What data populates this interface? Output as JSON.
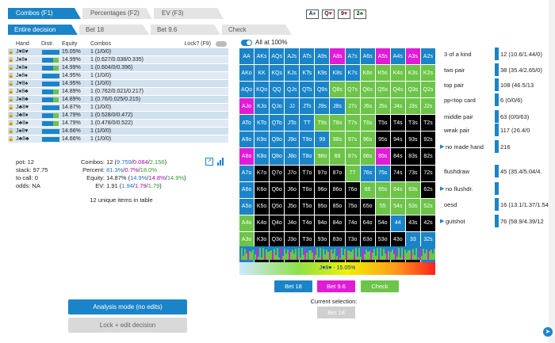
{
  "tabs_top": [
    {
      "label": "Combos (F1)",
      "active": true
    },
    {
      "label": "Percentages (F2)",
      "active": false
    },
    {
      "label": "EV (F3)",
      "active": false
    }
  ],
  "tabs_sub": [
    {
      "label": "Entire decision",
      "active": true
    },
    {
      "label": "Bet 18",
      "active": false
    },
    {
      "label": "Bet 9.6",
      "active": false
    },
    {
      "label": "Check",
      "active": false
    }
  ],
  "board": [
    {
      "rank": "A",
      "suit": "♦",
      "color": "#1b6fd0"
    },
    {
      "rank": "Q",
      "suit": "♥",
      "color": "#d11b1b"
    },
    {
      "rank": "9",
      "suit": "♥",
      "color": "#d11b1b"
    },
    {
      "rank": "2",
      "suit": "♣",
      "color": "#1e8a1e"
    }
  ],
  "hand_table": {
    "headers": {
      "hand": "Hand",
      "distr": "Distr.",
      "equity": "Equity",
      "combos": "Combos",
      "lock": "Lock? (F9)"
    },
    "rows": [
      {
        "hand": "J♥8♥",
        "equity": "15.05%",
        "combos": "1 (1/0/0)",
        "distr": "blue"
      },
      {
        "hand": "J♦8♦",
        "equity": "14.99%",
        "combos": "1 (0.627/0.038/0.335)",
        "distr": "mix"
      },
      {
        "hand": "J♦8♠",
        "equity": "14.99%",
        "combos": "1 (0.604/0/0.396)",
        "distr": "mix"
      },
      {
        "hand": "J♠8♠",
        "equity": "14.95%",
        "combos": "1 (1/0/0)",
        "distr": "blue"
      },
      {
        "hand": "J♥8♠",
        "equity": "14.95%",
        "combos": "1 (1/0/0)",
        "distr": "blue"
      },
      {
        "hand": "J♦8♣",
        "equity": "14.89%",
        "combos": "1 (0.762/0.021/0.217)",
        "distr": "mix"
      },
      {
        "hand": "J♠8♣",
        "equity": "14.89%",
        "combos": "1 (0.76/0.025/0.215)",
        "distr": "mix"
      },
      {
        "hand": "J♣8♥",
        "equity": "14.87%",
        "combos": "1 (1/0/0)",
        "distr": "blue"
      },
      {
        "hand": "J♣8♦",
        "equity": "14.79%",
        "combos": "1 (0.528/0/0.472)",
        "distr": "mix"
      },
      {
        "hand": "J♣8♠",
        "equity": "14.79%",
        "combos": "1 (0.478/0/0.522)",
        "distr": "mix"
      },
      {
        "hand": "J♠8♥",
        "equity": "14.66%",
        "combos": "1 (1/0/0)",
        "distr": "blue"
      },
      {
        "hand": "J♣8♣",
        "equity": "14.66%",
        "combos": "1 (1/0/0)",
        "distr": "blue"
      }
    ]
  },
  "stats": {
    "pot": "pot: 12",
    "stack": "stack: 97.75",
    "to_call": "to call: 0",
    "odds": "odds: NA",
    "combos_label": "Combos:",
    "combos_a": "12 (",
    "combos_b": "9.759",
    "combos_c": "/",
    "combos_d": "0.084",
    "combos_e": "/",
    "combos_f": "2.156",
    "combos_g": ")",
    "percent_label": "Percent:",
    "percent_b": "81.3%",
    "percent_d": "0.7%",
    "percent_f": "18.0%",
    "equity_label": "Equity:",
    "equity_a": "14.87% (",
    "equity_b": "14.9%",
    "equity_d": "14.8%",
    "equity_f": "14.9%",
    "equity_g": ")",
    "ev_label": "EV:",
    "ev_a": "1.91 (",
    "ev_b": "1.94",
    "ev_d": "1.79",
    "ev_f": "1.79",
    "ev_g": ")",
    "unique": "12 unique items in table"
  },
  "buttons": {
    "analysis": "Analysis mode (no edits)",
    "lock": "Lock + edit decision"
  },
  "grid": {
    "all_label": "All at 100%",
    "cells": [
      "AA",
      "AKs",
      "AQs",
      "AJs",
      "ATs",
      "A9s",
      "A8s",
      "A7s",
      "A6s",
      "A5s",
      "A4s",
      "A3s",
      "A2s",
      "AKo",
      "KK",
      "KQs",
      "KJs",
      "KTs",
      "K9s",
      "K8s",
      "K7s",
      "K6s",
      "K5s",
      "K4s",
      "K3s",
      "K2s",
      "AQo",
      "KQo",
      "QQ",
      "QJs",
      "QTs",
      "Q9s",
      "Q8s",
      "Q7s",
      "Q6s",
      "Q5s",
      "Q4s",
      "Q3s",
      "Q2s",
      "AJo",
      "KJo",
      "QJo",
      "JJ",
      "JTs",
      "J9s",
      "J8s",
      "J7s",
      "J6s",
      "J5s",
      "J4s",
      "J3s",
      "J2s",
      "ATo",
      "KTo",
      "QTo",
      "JTo",
      "TT",
      "T9s",
      "T8s",
      "T7s",
      "T6s",
      "T5s",
      "T4s",
      "T3s",
      "T2s",
      "A9o",
      "K9o",
      "Q9o",
      "J9o",
      "T9o",
      "99",
      "98s",
      "97s",
      "96s",
      "95s",
      "94s",
      "93s",
      "92s",
      "A8o",
      "K8o",
      "Q8o",
      "J8o",
      "T8o",
      "98o",
      "88",
      "87s",
      "86s",
      "85s",
      "84s",
      "83s",
      "82s",
      "A7o",
      "K7o",
      "Q7o",
      "J7o",
      "T7o",
      "97o",
      "87o",
      "77",
      "76s",
      "75s",
      "74s",
      "73s",
      "72s",
      "A6o",
      "K6o",
      "Q6o",
      "J6o",
      "T6o",
      "96o",
      "86o",
      "76o",
      "66",
      "65s",
      "64s",
      "63s",
      "62s",
      "A5o",
      "K5o",
      "Q5o",
      "J5o",
      "T5o",
      "95o",
      "85o",
      "75o",
      "65o",
      "55",
      "54s",
      "53s",
      "52s",
      "A4o",
      "K4o",
      "Q4o",
      "J4o",
      "T4o",
      "94o",
      "84o",
      "74o",
      "64o",
      "54o",
      "44",
      "43s",
      "42s",
      "A3o",
      "K3o",
      "Q3o",
      "J3o",
      "T3o",
      "93o",
      "83o",
      "73o",
      "63o",
      "53o",
      "43o",
      "33",
      "32s",
      "A2o",
      "K2o",
      "Q2o",
      "J2o",
      "T2o",
      "92o",
      "82o",
      "72o",
      "62o",
      "52o",
      "42o",
      "32o",
      "22"
    ],
    "colors": [
      "#1b84c8",
      "#1b84c8",
      "#1b84c8",
      "#1b84c8",
      "#1b84c8",
      "#1b84c8",
      "#e01cd6",
      "#1b84c8",
      "#1b84c8",
      "#e01cd6",
      "#1b84c8",
      "#e01cd6",
      "#1b84c8",
      "#1b84c8",
      "#1b84c8",
      "#1b84c8",
      "#1b84c8",
      "#1b84c8",
      "#1b84c8",
      "#1b84c8",
      "#1b84c8",
      "#6cc448",
      "#6cc448",
      "#6cc448",
      "#6cc448",
      "#6cc448",
      "#1b84c8",
      "#1b84c8",
      "#1b84c8",
      "#1b84c8",
      "#1b84c8",
      "#1b84c8",
      "#6cc448",
      "#6cc448",
      "#6cc448",
      "#6cc448",
      "#6cc448",
      "#6cc448",
      "#6cc448",
      "#e01cd6",
      "#1b84c8",
      "#1b84c8",
      "#1b84c8",
      "#1b84c8",
      "#1b84c8",
      "#1b84c8",
      "#6cc448",
      "#6cc448",
      "#6cc448",
      "#6cc448",
      "#6cc448",
      "#6cc448",
      "#1b84c8",
      "#1b84c8",
      "#1b84c8",
      "#1b84c8",
      "#1b84c8",
      "#6cc448",
      "#6cc448",
      "#6cc448",
      "#6cc448",
      "#000000",
      "#000000",
      "#000000",
      "#000000",
      "#1b84c8",
      "#1b84c8",
      "#1b84c8",
      "#1b84c8",
      "#1b84c8",
      "#1b84c8",
      "#6cc448",
      "#6cc448",
      "#6cc448",
      "#000000",
      "#000000",
      "#000000",
      "#000000",
      "#e01cd6",
      "#1b84c8",
      "#1b84c8",
      "#1b84c8",
      "#1b84c8",
      "#6cc448",
      "#6cc448",
      "#6cc448",
      "#6cc448",
      "#e01cd6",
      "#000000",
      "#000000",
      "#000000",
      "#1b84c8",
      "#000000",
      "#000000",
      "#000000",
      "#000000",
      "#000000",
      "#000000",
      "#6cc448",
      "#1b84c8",
      "#1b84c8",
      "#000000",
      "#000000",
      "#000000",
      "#1b84c8",
      "#000000",
      "#000000",
      "#000000",
      "#000000",
      "#000000",
      "#000000",
      "#000000",
      "#6cc448",
      "#6cc448",
      "#6cc448",
      "#6cc448",
      "#000000",
      "#1b84c8",
      "#000000",
      "#000000",
      "#000000",
      "#000000",
      "#000000",
      "#000000",
      "#000000",
      "#000000",
      "#6cc448",
      "#6cc448",
      "#6cc448",
      "#6cc448",
      "#6cc448",
      "#000000",
      "#000000",
      "#000000",
      "#000000",
      "#000000",
      "#000000",
      "#000000",
      "#000000",
      "#000000",
      "#1b84c8",
      "#000000",
      "#000000",
      "#6cc448",
      "#000000",
      "#000000",
      "#000000",
      "#000000",
      "#000000",
      "#000000",
      "#000000",
      "#000000",
      "#000000",
      "#000000",
      "#1b84c8",
      "#1b84c8",
      "#1b84c8",
      "#000000",
      "#000000",
      "#000000",
      "#000000",
      "#000000",
      "#000000",
      "#000000",
      "#000000",
      "#000000",
      "#000000",
      "#000000",
      "#1b84c8"
    ]
  },
  "equity_bar_label": "J♥8♥ - 15.05%",
  "actions": {
    "bet18": "Bet 18",
    "bet96": "Bet 9.6",
    "check": "Check",
    "current_label": "Current selection:",
    "current_value": "Bet 18"
  },
  "right_stats": [
    {
      "label": "3 of a kind",
      "val": "12 (10.6/1.44/0)",
      "arrow": false
    },
    {
      "label": "two pair",
      "val": "38 (35.4/2.65/0)",
      "arrow": false
    },
    {
      "label": "top pair",
      "val": "108 (46.5/13",
      "arrow": false
    },
    {
      "label": "pp<top card",
      "val": "6 (0/0/6)",
      "arrow": false
    },
    {
      "label": "middle pair",
      "val": "63 (0/0/63)",
      "arrow": false
    },
    {
      "label": "weak pair",
      "val": "117 (26.4/0",
      "arrow": false
    },
    {
      "label": "no made hand",
      "val": "216",
      "arrow": true
    },
    {
      "label": "flushdraw",
      "val": "45 (35.4/5.04/4.",
      "arrow": false
    },
    {
      "label": "no flushdr.",
      "val": "",
      "arrow": true
    },
    {
      "label": "oesd",
      "val": "16 (13.1/1.37/1.54",
      "arrow": false
    },
    {
      "label": "gutshot",
      "val": "76 (58.9/4.39/12",
      "arrow": true
    }
  ]
}
